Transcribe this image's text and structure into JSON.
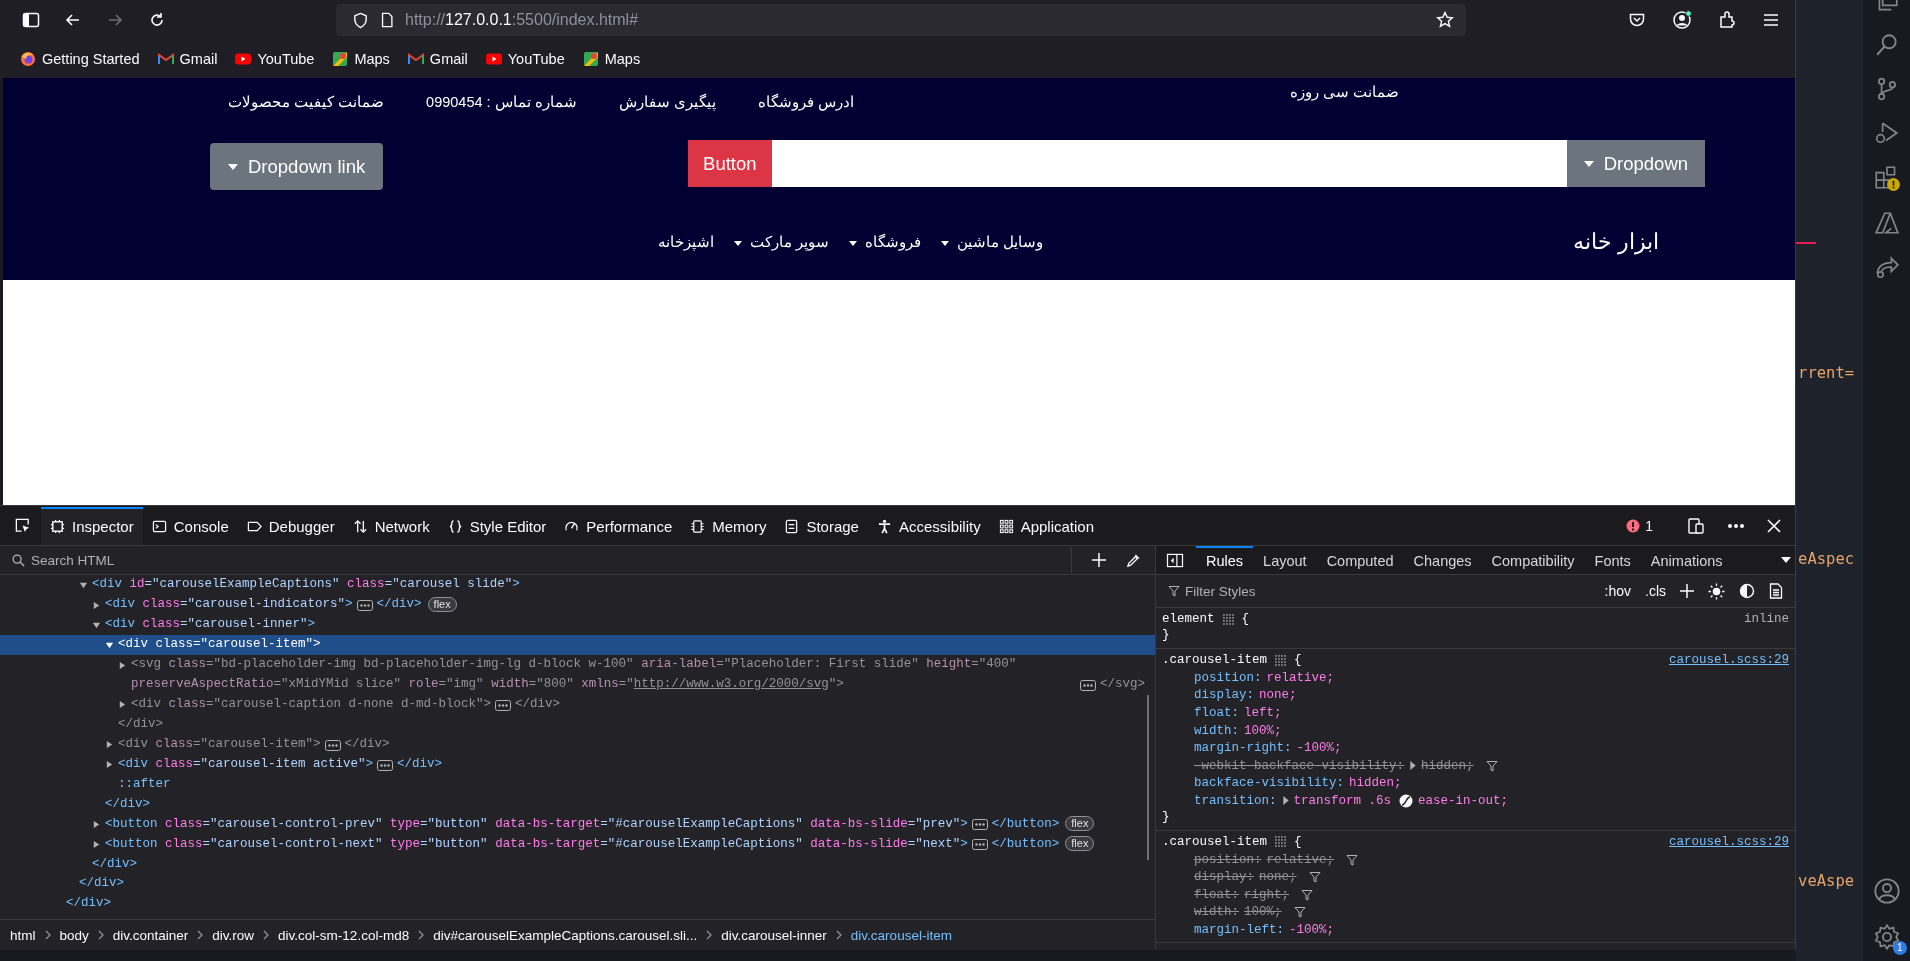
{
  "browser": {
    "nav_buttons": [
      {
        "kind": "back",
        "disabled": false
      },
      {
        "kind": "forward",
        "disabled": true
      },
      {
        "kind": "reload",
        "disabled": false
      }
    ],
    "url": {
      "scheme": "http://",
      "host": "127.0.0.1",
      "rest": ":5500/index.html#"
    },
    "bookmarks": [
      {
        "label": "Getting Started",
        "kind": "firefox"
      },
      {
        "label": "Gmail",
        "kind": "gmail"
      },
      {
        "label": "YouTube",
        "kind": "youtube"
      },
      {
        "label": "Maps",
        "kind": "maps"
      },
      {
        "label": "Gmail",
        "kind": "gmail"
      },
      {
        "label": "YouTube",
        "kind": "youtube"
      },
      {
        "label": "Maps",
        "kind": "maps"
      }
    ]
  },
  "page": {
    "guarantee": "ضمانت سی روزه",
    "top_links": [
      "ادرس فروشگاه",
      "پیگیری سفارش",
      "شماره تماس : 0990454",
      "ضمانت کیفیت محصولات"
    ],
    "search_dropdown": "Dropdown",
    "search_button": "Button",
    "dropdown_link": "Dropdown link",
    "brand": "ابزار خانه",
    "nav": [
      {
        "label": "وسایل ماشین",
        "dropdown": true
      },
      {
        "label": "فروشگاه",
        "dropdown": true
      },
      {
        "label": "سوپر مارکت",
        "dropdown": true
      },
      {
        "label": "اشپزخانه",
        "dropdown": false
      }
    ]
  },
  "devtools": {
    "tabs": [
      {
        "label": "Inspector",
        "kind": "inspector",
        "selected": true
      },
      {
        "label": "Console",
        "kind": "console",
        "selected": false
      },
      {
        "label": "Debugger",
        "kind": "debugger",
        "selected": false
      },
      {
        "label": "Network",
        "kind": "network",
        "selected": false
      },
      {
        "label": "Style Editor",
        "kind": "style",
        "selected": false
      },
      {
        "label": "Performance",
        "kind": "performance",
        "selected": false
      },
      {
        "label": "Memory",
        "kind": "memory",
        "selected": false
      },
      {
        "label": "Storage",
        "kind": "storage",
        "selected": false
      },
      {
        "label": "Accessibility",
        "kind": "accessibility",
        "selected": false
      },
      {
        "label": "Application",
        "kind": "application",
        "selected": false
      }
    ],
    "error_count": "1",
    "search_placeholder": "Search HTML",
    "tree": [
      {
        "kind": "scrolled",
        "closing": "</div>",
        "children": [
          {
            "kind": "scrolled",
            "closing": "</div>",
            "children": [
              {
                "kind": "element",
                "tag": "<div",
                "attrs": [
                  {
                    "text": "id=\"carouselExampleCaptions\""
                  },
                  {
                    "text": "class=\"carousel slide\""
                  }
                ],
                "end": ">",
                "expanded": true,
                "selected": false,
                "dimmed": false,
                "closing": "</div>",
                "children": [
                  {
                    "kind": "element",
                    "tag": "<div",
                    "attrs": [
                      {
                        "text": "class=\"carousel-indicators\""
                      }
                    ],
                    "end": ">",
                    "expanded": false,
                    "selected": false,
                    "dimmed": false,
                    "closing": "</div>",
                    "badge": "flex"
                  },
                  {
                    "kind": "element",
                    "tag": "<div",
                    "attrs": [
                      {
                        "text": "class=\"carousel-inner\""
                      }
                    ],
                    "end": ">",
                    "expanded": true,
                    "selected": false,
                    "dimmed": false,
                    "closing": "</div>",
                    "children": [
                      {
                        "kind": "element",
                        "tag": "<div",
                        "attrs": [
                          {
                            "text": "class=\"carousel-item\""
                          }
                        ],
                        "end": ">",
                        "expanded": true,
                        "selected": true,
                        "dimmed": false,
                        "closing": "</div>",
                        "children": [
                          {
                            "kind": "element",
                            "tag": "<svg",
                            "attrs": [
                              {
                                "text": "class=\"bd-placeholder-img bd-placeholder-img-lg d-block w-100\""
                              },
                              {
                                "text": "aria-label=\"Placeholder: First slide\""
                              },
                              {
                                "text": "height=\"400\""
                              },
                              {
                                "text": "preserveAspectRatio=\"xMidYMid slice\""
                              },
                              {
                                "text": "role=\"img\""
                              },
                              {
                                "text": "width=\"800\""
                              },
                              {
                                "text": "xmlns=\"http://www.w3.org/2000/svg\"",
                                "link": true
                              }
                            ],
                            "end": ">",
                            "expanded": false,
                            "selected": false,
                            "dimmed": true,
                            "closing": "</svg>"
                          },
                          {
                            "kind": "element",
                            "tag": "<div",
                            "attrs": [
                              {
                                "text": "class=\"carousel-caption d-none d-md-block\""
                              }
                            ],
                            "end": ">",
                            "expanded": false,
                            "selected": false,
                            "dimmed": true,
                            "closing": "</div>"
                          }
                        ]
                      },
                      {
                        "kind": "element",
                        "tag": "<div",
                        "attrs": [
                          {
                            "text": "class=\"carousel-item\""
                          }
                        ],
                        "end": ">",
                        "expanded": false,
                        "selected": false,
                        "dimmed": true,
                        "closing": "</div>"
                      },
                      {
                        "kind": "element",
                        "tag": "<div",
                        "attrs": [
                          {
                            "text": "class=\"carousel-item active\""
                          }
                        ],
                        "end": ">",
                        "expanded": false,
                        "selected": false,
                        "dimmed": false,
                        "closing": "</div>"
                      },
                      {
                        "kind": "pseudo",
                        "text": "::after"
                      }
                    ]
                  },
                  {
                    "kind": "element",
                    "tag": "<button",
                    "attrs": [
                      {
                        "text": "class=\"carousel-control-prev\""
                      },
                      {
                        "text": "type=\"button\""
                      },
                      {
                        "text": "data-bs-target=\"#carouselExampleCaptions\""
                      },
                      {
                        "text": "data-bs-slide=\"prev\""
                      }
                    ],
                    "end": ">",
                    "expanded": false,
                    "selected": false,
                    "dimmed": false,
                    "closing": "</button>",
                    "badge": "flex"
                  },
                  {
                    "kind": "element",
                    "tag": "<button",
                    "attrs": [
                      {
                        "text": "class=\"carousel-control-next\""
                      },
                      {
                        "text": "type=\"button\""
                      },
                      {
                        "text": "data-bs-target=\"#carouselExampleCaptions\""
                      },
                      {
                        "text": "data-bs-slide=\"next\""
                      }
                    ],
                    "end": ">",
                    "expanded": false,
                    "selected": false,
                    "dimmed": false,
                    "closing": "</button>",
                    "badge": "flex"
                  }
                ]
              }
            ]
          }
        ]
      }
    ],
    "breadcrumbs": [
      {
        "label": "html",
        "selected": false
      },
      {
        "label": "body",
        "selected": false
      },
      {
        "label": "div.container",
        "selected": false
      },
      {
        "label": "div.row",
        "selected": false
      },
      {
        "label": "div.col-sm-12.col-md8",
        "selected": false
      },
      {
        "label": "div#carouselExampleCaptions.carousel.sli...",
        "selected": false
      },
      {
        "label": "div.carousel-inner",
        "selected": false
      },
      {
        "label": "div.carousel-item",
        "selected": true
      }
    ],
    "side_tabs": [
      {
        "label": "Rules",
        "selected": true
      },
      {
        "label": "Layout",
        "selected": false
      },
      {
        "label": "Computed",
        "selected": false
      },
      {
        "label": "Changes",
        "selected": false
      },
      {
        "label": "Compatibility",
        "selected": false
      },
      {
        "label": "Fonts",
        "selected": false
      },
      {
        "label": "Animations",
        "selected": false
      }
    ],
    "filter_placeholder": "Filter Styles",
    "hov": ":hov",
    "cls": ".cls",
    "rules": [
      {
        "selector": "element",
        "open": "{",
        "close": "}",
        "source": "inline",
        "source_link": false
      },
      {
        "selector": ".carousel-item",
        "open": "{",
        "close": "}",
        "source": "carousel.scss:29",
        "source_link": true,
        "declarations": [
          {
            "property": "position:",
            "value": "relative;",
            "overridden": false
          },
          {
            "property": "display:",
            "value": "none;",
            "overridden": false
          },
          {
            "property": "float:",
            "value": "left;",
            "overridden": false
          },
          {
            "property": "width:",
            "value": "100%;",
            "overridden": false
          },
          {
            "property": "margin-right:",
            "value": "-100%;",
            "overridden": false
          },
          {
            "property": "-webkit-backface-visibility:",
            "value": "hidden;",
            "overridden": true,
            "expandable": true
          },
          {
            "property": "backface-visibility:",
            "value": "hidden;",
            "overridden": false
          },
          {
            "property": "transition:",
            "value": "transform .6s",
            "easing": "ease-in-out;",
            "overridden": false,
            "expandable": true
          }
        ]
      },
      {
        "selector": ".carousel-item",
        "open": "{",
        "source": "carousel.scss:29",
        "source_link": true,
        "declarations": [
          {
            "property": "position:",
            "value": "relative;",
            "overridden": true
          },
          {
            "property": "display:",
            "value": "none;",
            "overridden": true
          },
          {
            "property": "float:",
            "value": "right;",
            "overridden": true
          },
          {
            "property": "width:",
            "value": "100%;",
            "overridden": true
          },
          {
            "property": "margin-left:",
            "value": "-100%;",
            "overridden": false
          }
        ]
      }
    ]
  },
  "editor": {
    "fragments": [
      "rrent=",
      "eAspec",
      "veAspe"
    ],
    "settings_badge": "1"
  }
}
